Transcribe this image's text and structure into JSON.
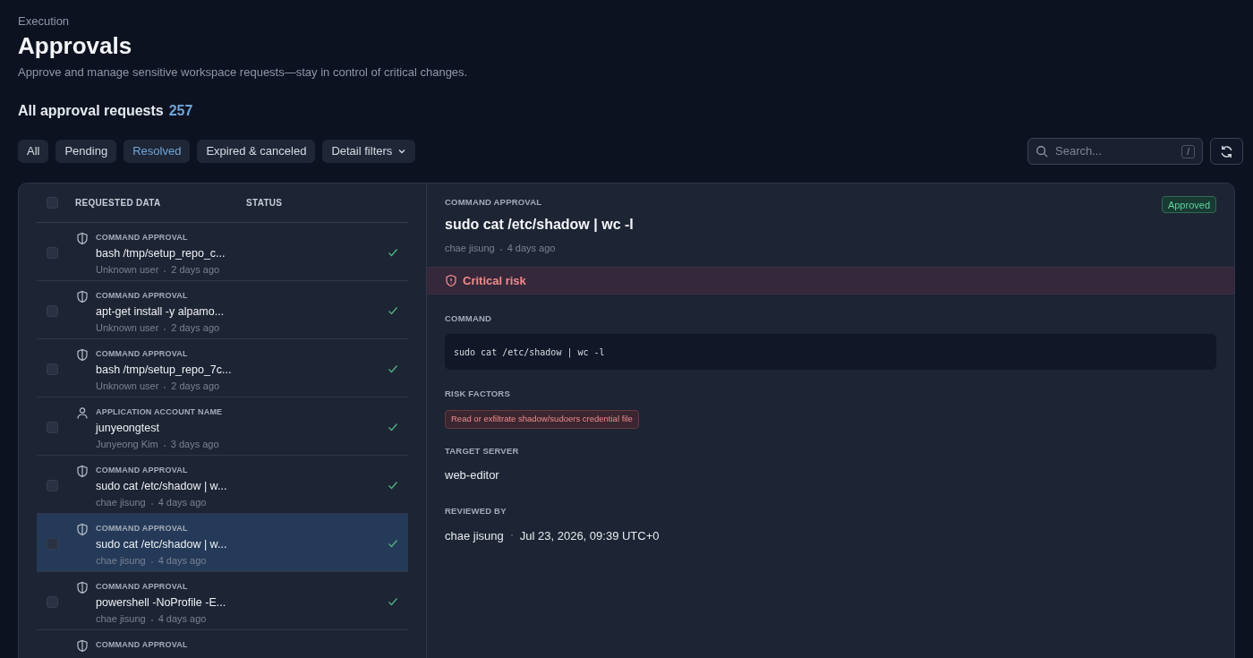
{
  "header": {
    "breadcrumb": "Execution",
    "title": "Approvals",
    "subtitle": "Approve and manage sensitive workspace requests—stay in control of critical changes."
  },
  "summary": {
    "label": "All approval requests",
    "count": "257"
  },
  "filters": [
    {
      "label": "All",
      "selected": false
    },
    {
      "label": "Pending",
      "selected": false
    },
    {
      "label": "Resolved",
      "selected": true
    },
    {
      "label": "Expired & canceled",
      "selected": false
    },
    {
      "label": "Detail filters",
      "selected": false,
      "kind": "dropdown"
    }
  ],
  "search": {
    "placeholder": "Search...",
    "shortcut": "/"
  },
  "table": {
    "select_all": {
      "checked": false
    },
    "columns": [
      "REQUESTED DATA",
      "STATUS"
    ],
    "rows": [
      {
        "kind": "command",
        "label": "COMMAND APPROVAL",
        "title": "bash /tmp/setup_repo_c...",
        "user": "Unknown user",
        "time": "2 days ago",
        "approved": true,
        "checked": false,
        "selected": false
      },
      {
        "kind": "command",
        "label": "COMMAND APPROVAL",
        "title": "apt-get install -y alpamo...",
        "user": "Unknown user",
        "time": "2 days ago",
        "approved": true,
        "checked": false,
        "selected": false
      },
      {
        "kind": "command",
        "label": "COMMAND APPROVAL",
        "title": "bash /tmp/setup_repo_7c...",
        "user": "Unknown user",
        "time": "2 days ago",
        "approved": true,
        "checked": false,
        "selected": false
      },
      {
        "kind": "account",
        "label": "APPLICATION ACCOUNT NAME",
        "title": "junyeongtest",
        "user": "Junyeong Kim",
        "time": "3 days ago",
        "approved": true,
        "checked": false,
        "selected": false
      },
      {
        "kind": "command",
        "label": "COMMAND APPROVAL",
        "title": "sudo cat /etc/shadow | w...",
        "user": "chae jisung",
        "time": "4 days ago",
        "approved": true,
        "checked": false,
        "selected": false
      },
      {
        "kind": "command",
        "label": "COMMAND APPROVAL",
        "title": "sudo cat /etc/shadow | w...",
        "user": "chae jisung",
        "time": "4 days ago",
        "approved": true,
        "checked": false,
        "selected": true
      },
      {
        "kind": "command",
        "label": "COMMAND APPROVAL",
        "title": "powershell -NoProfile -E...",
        "user": "chae jisung",
        "time": "4 days ago",
        "approved": true,
        "checked": false,
        "selected": false
      },
      {
        "kind": "command",
        "label": "COMMAND APPROVAL"
      }
    ]
  },
  "detail": {
    "label": "COMMAND APPROVAL",
    "title": "sudo cat /etc/shadow | wc -l",
    "user": "chae jisung",
    "time": "4 days ago",
    "status": "Approved",
    "risk": "Critical risk",
    "command_label": "COMMAND",
    "command": "sudo cat /etc/shadow | wc -l",
    "risk_factors_label": "RISK FACTORS",
    "risk_factors": [
      "Read or exfiltrate shadow/sudoers credential file"
    ],
    "target_label": "TARGET SERVER",
    "target": "web-editor",
    "reviewed_label": "REVIEWED BY",
    "reviewer": "chae jisung",
    "reviewed_at": "Jul 23, 2026, 09:39 UTC+0"
  }
}
